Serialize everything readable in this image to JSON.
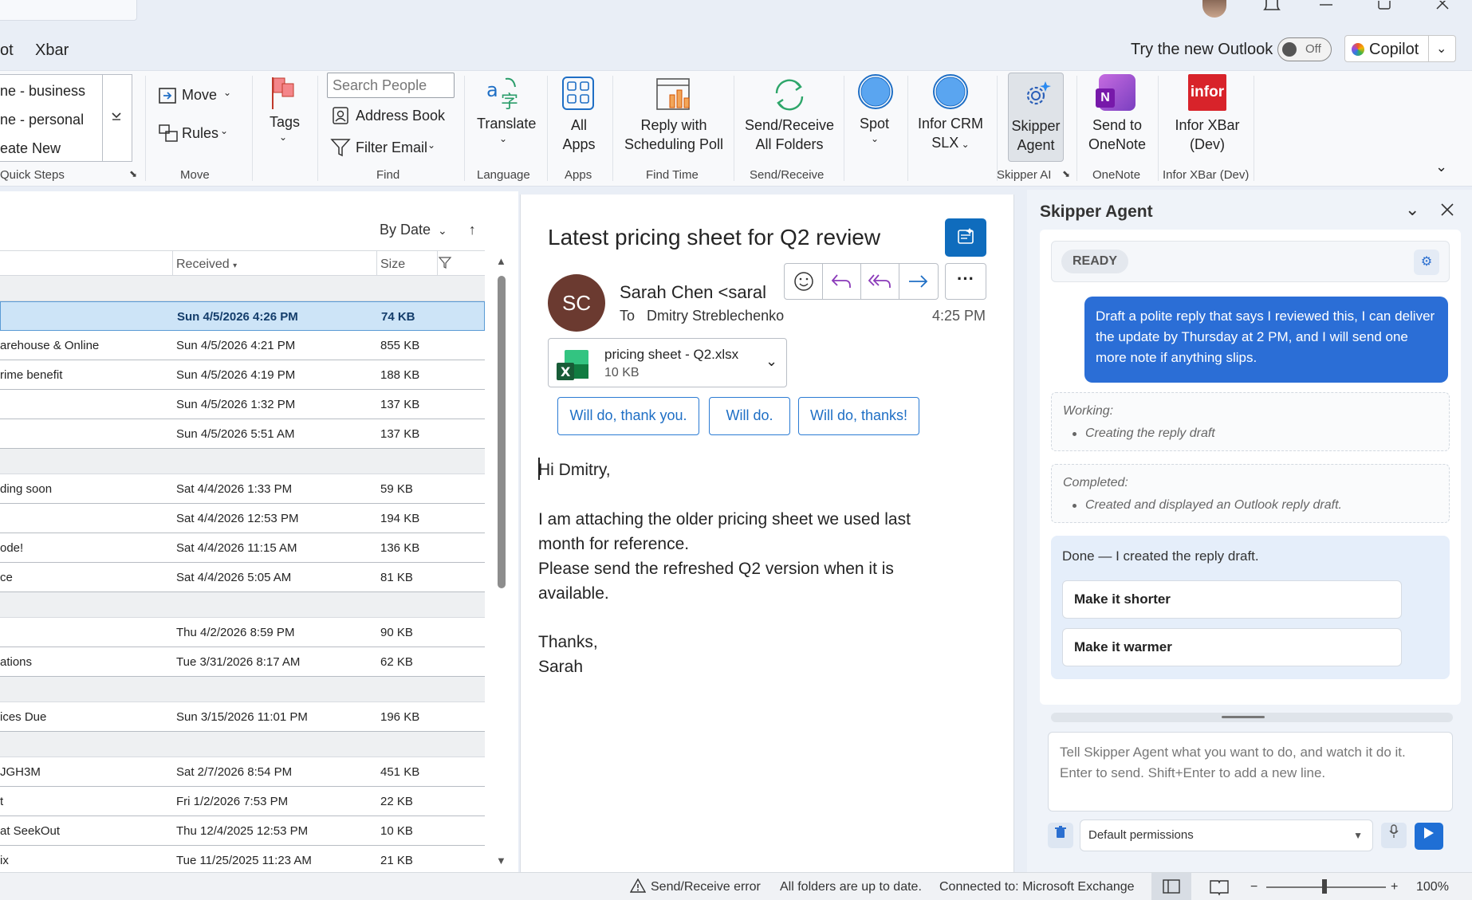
{
  "menu": {
    "items": [
      "ot",
      "Xbar"
    ],
    "try_outlook": "Try the new Outlook",
    "toggle_label": "Off",
    "copilot": "Copilot"
  },
  "ribbon": {
    "quick_steps": {
      "items": [
        "ne - business",
        "ne - personal",
        "eate New"
      ],
      "label": "Quick Steps"
    },
    "move": {
      "move_btn": "Move",
      "rules_btn": "Rules",
      "label": "Move"
    },
    "tags": {
      "label_btn": "Tags"
    },
    "find": {
      "search_placeholder": "Search People",
      "address_book": "Address Book",
      "filter_email": "Filter Email",
      "label": "Find"
    },
    "language": {
      "translate": "Translate",
      "label": "Language"
    },
    "apps": {
      "line1": "All",
      "line2": "Apps",
      "label": "Apps"
    },
    "findtime": {
      "line1": "Reply with",
      "line2": "Scheduling Poll",
      "label": "Find Time"
    },
    "sendreceive": {
      "line1": "Send/Receive",
      "line2": "All Folders",
      "label": "Send/Receive"
    },
    "spot": {
      "label_btn": "Spot"
    },
    "infor_crm": {
      "line1": "Infor CRM",
      "line2": "SLX"
    },
    "skipper": {
      "line1": "Skipper",
      "line2": "Agent",
      "label": "Skipper AI"
    },
    "onenote": {
      "line1": "Send to",
      "line2": "OneNote",
      "label": "OneNote",
      "icon_letter": "N"
    },
    "inforxbar": {
      "logo": "infor",
      "line1": "Infor XBar",
      "line2": "(Dev)",
      "label": "Infor XBar (Dev)"
    }
  },
  "maillist": {
    "sort": "By Date",
    "headers": {
      "received": "Received",
      "size": "Size"
    },
    "rows": [
      {
        "type": "group"
      },
      {
        "type": "mail",
        "subject": "",
        "received": "Sun 4/5/2026 4:26 PM",
        "size": "74 KB",
        "selected": true
      },
      {
        "type": "mail",
        "subject": "arehouse & Online",
        "received": "Sun 4/5/2026 4:21 PM",
        "size": "855 KB"
      },
      {
        "type": "mail",
        "subject": "rime benefit",
        "received": "Sun 4/5/2026 4:19 PM",
        "size": "188 KB"
      },
      {
        "type": "mail",
        "subject": "",
        "received": "Sun 4/5/2026 1:32 PM",
        "size": "137 KB"
      },
      {
        "type": "mail",
        "subject": "",
        "received": "Sun 4/5/2026 5:51 AM",
        "size": "137 KB"
      },
      {
        "type": "group"
      },
      {
        "type": "mail",
        "subject": "ding soon",
        "received": "Sat 4/4/2026 1:33 PM",
        "size": "59 KB"
      },
      {
        "type": "mail",
        "subject": "",
        "received": "Sat 4/4/2026 12:53 PM",
        "size": "194 KB"
      },
      {
        "type": "mail",
        "subject": "ode!",
        "received": "Sat 4/4/2026 11:15 AM",
        "size": "136 KB"
      },
      {
        "type": "mail",
        "subject": "ce",
        "received": "Sat 4/4/2026 5:05 AM",
        "size": "81 KB"
      },
      {
        "type": "group"
      },
      {
        "type": "mail",
        "subject": "",
        "received": "Thu 4/2/2026 8:59 PM",
        "size": "90 KB"
      },
      {
        "type": "mail",
        "subject": "ations",
        "received": "Tue 3/31/2026 8:17 AM",
        "size": "62 KB"
      },
      {
        "type": "group"
      },
      {
        "type": "mail",
        "subject": "ices Due",
        "received": "Sun 3/15/2026 11:01 PM",
        "size": "196 KB"
      },
      {
        "type": "group"
      },
      {
        "type": "mail",
        "subject": "JGH3M",
        "received": "Sat 2/7/2026 8:54 PM",
        "size": "451 KB"
      },
      {
        "type": "mail",
        "subject": "t",
        "received": "Fri 1/2/2026 7:53 PM",
        "size": "22 KB"
      },
      {
        "type": "mail",
        "subject": "at SeekOut",
        "received": "Thu 12/4/2025 12:53 PM",
        "size": "10 KB"
      },
      {
        "type": "mail",
        "subject": "ix",
        "received": "Tue 11/25/2025 11:23 AM",
        "size": "21 KB"
      }
    ]
  },
  "reading": {
    "subject": "Latest pricing sheet for Q2 review",
    "avatar_initials": "SC",
    "sender": "Sarah Chen <saral",
    "to_label": "To",
    "to": "Dmitry Streblechenko",
    "time": "4:25 PM",
    "attachment": {
      "name": "pricing sheet - Q2.xlsx",
      "size": "10 KB"
    },
    "quick_replies": [
      "Will do, thank you.",
      "Will do.",
      "Will do, thanks!"
    ],
    "body": {
      "greeting": "Hi Dmitry,",
      "line1": "I am attaching the older pricing sheet we used last",
      "line2": "month for reference.",
      "line3": "Please send the refreshed Q2 version when it is",
      "line4": "available.",
      "signoff": "Thanks,",
      "name": "Sarah"
    }
  },
  "skipper": {
    "title": "Skipper Agent",
    "status": "READY",
    "user_message": "Draft a polite reply that says I reviewed this, I can deliver the update by Thursday at 2 PM, and I will send one more note if anything slips.",
    "working": {
      "title": "Working:",
      "item": "Creating the reply draft"
    },
    "completed": {
      "title": "Completed:",
      "item": "Created and displayed an Outlook reply draft."
    },
    "done": "Done — I created the reply draft.",
    "suggestions": [
      "Make it shorter",
      "Make it warmer"
    ],
    "input_placeholder": "Tell Skipper Agent what you want to do, and watch it do it. Enter to send. Shift+Enter to add a new line.",
    "permissions": "Default permissions"
  },
  "statusbar": {
    "error": "Send/Receive error",
    "uptodate": "All folders are up to date.",
    "connected": "Connected to: Microsoft Exchange",
    "zoom": "100%"
  }
}
